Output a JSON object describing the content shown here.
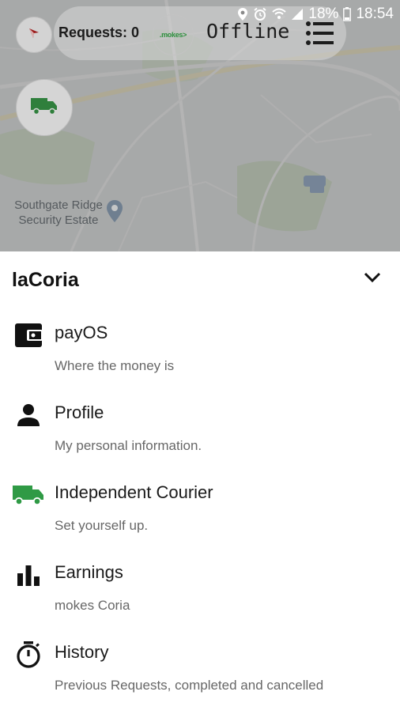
{
  "status_bar": {
    "battery_percent": "18%",
    "time": "18:54",
    "icons": [
      "location-icon",
      "alarm-icon",
      "wifi-icon",
      "signal-icon",
      "battery-icon"
    ]
  },
  "top_bar": {
    "requests_label": "Requests: 0",
    "logo_text": ".mokes>",
    "status_text": "Offline",
    "menu_icon": "list-menu-icon",
    "compass_icon": "compass-icon"
  },
  "map": {
    "place_label": "Southgate Ridge Security Estate",
    "courier_button_icon": "truck-icon"
  },
  "sheet": {
    "title": "laCoria",
    "collapse_icon": "chevron-down-icon",
    "items": [
      {
        "title": "payOS",
        "subtitle": "Where the money is",
        "icon": "wallet-icon"
      },
      {
        "title": "Profile",
        "subtitle": "My personal information.",
        "icon": "person-icon"
      },
      {
        "title": "Independent Courier",
        "subtitle": "Set yourself up.",
        "icon": "truck-icon"
      },
      {
        "title": "Earnings",
        "subtitle": "mokes Coria",
        "icon": "bar-chart-icon"
      },
      {
        "title": "History",
        "subtitle": "Previous Requests, completed and cancelled",
        "icon": "stopwatch-icon"
      }
    ]
  },
  "colors": {
    "brand_green": "#2f9a45",
    "map_dim": "#8f9092"
  }
}
